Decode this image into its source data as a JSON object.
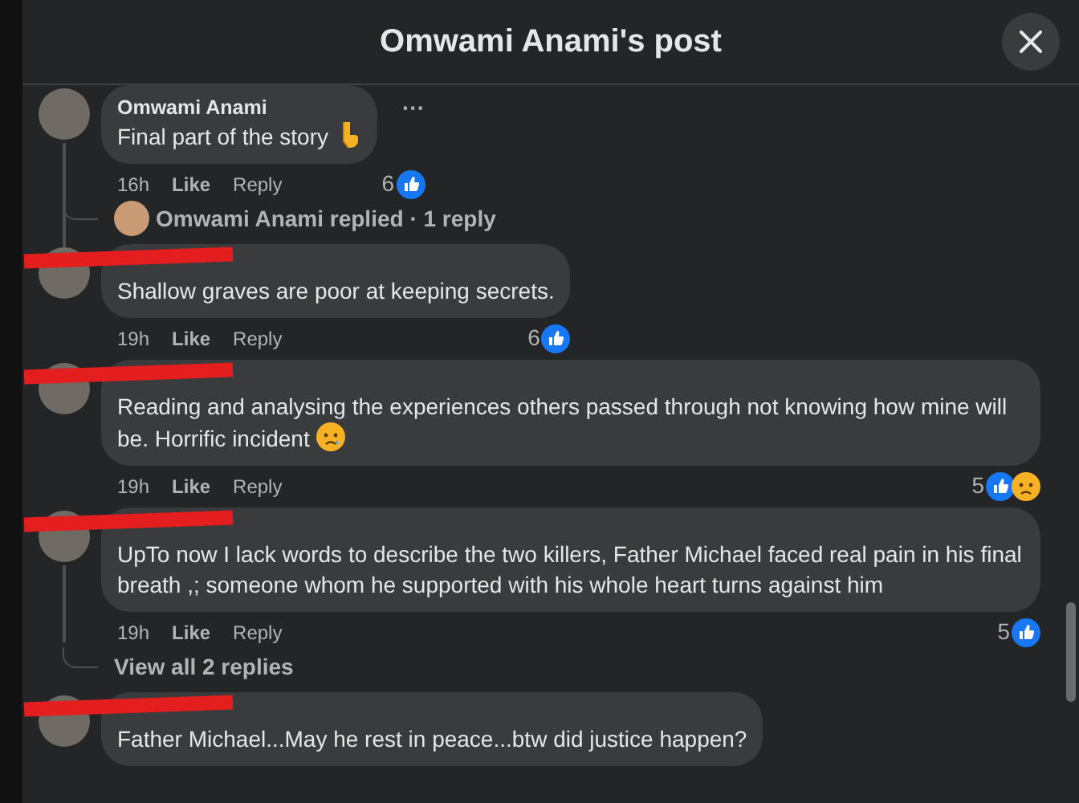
{
  "dialog": {
    "title": "Omwami Anami's post"
  },
  "comments": [
    {
      "author": "Omwami Anami",
      "name_redacted": false,
      "text": "Final part of the story",
      "emoji": {
        "kind": "pointing-down"
      },
      "time": "16h",
      "like": "Like",
      "reply": "Reply",
      "reaction_count": "6",
      "reactions": [
        {
          "kind": "like"
        }
      ],
      "replies_summary": {
        "kind": "replied",
        "text": "Omwami Anami replied · 1 reply"
      },
      "more_menu": "···"
    },
    {
      "name_redacted": true,
      "text": "Shallow graves are poor at keeping secrets.",
      "time": "19h",
      "like": "Like",
      "reply": "Reply",
      "reaction_count": "6",
      "reactions": [
        {
          "kind": "like"
        }
      ]
    },
    {
      "name_redacted": true,
      "text": "Reading and analysing the experiences others passed through not knowing how mine will be. Horrific incident",
      "emoji": {
        "kind": "sad-tear"
      },
      "time": "19h",
      "like": "Like",
      "reply": "Reply",
      "reaction_count": "5",
      "reactions": [
        {
          "kind": "like"
        },
        {
          "kind": "sad"
        }
      ]
    },
    {
      "name_redacted": true,
      "text": "UpTo now I lack words to describe the two killers, Father Michael faced real pain in his final breath ,; someone whom he supported with his whole heart turns against him",
      "time": "19h",
      "like": "Like",
      "reply": "Reply",
      "reaction_count": "5",
      "reactions": [
        {
          "kind": "like"
        }
      ],
      "replies_summary": {
        "kind": "view_all",
        "text": "View all 2 replies"
      }
    },
    {
      "name_redacted": true,
      "text": "Father Michael...May he rest in peace...btw did justice happen?"
    }
  ]
}
